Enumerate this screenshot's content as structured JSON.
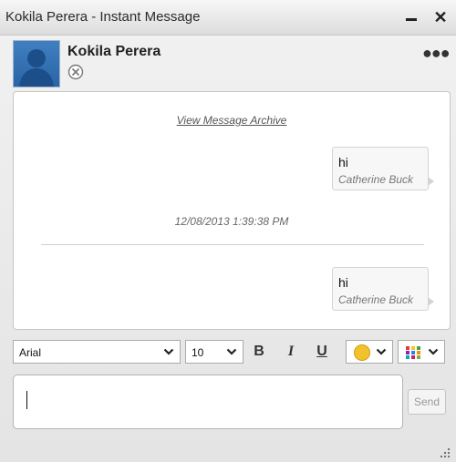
{
  "window": {
    "title": "Kokila Perera - Instant Message"
  },
  "contact": {
    "name": "Kokila Perera",
    "status_icon": "offline-status-icon"
  },
  "conversation": {
    "archive_link": "View Message Archive",
    "messages": [
      {
        "text": "hi",
        "sender": "Catherine Buck"
      },
      {
        "text": "hi",
        "sender": "Catherine Buck"
      }
    ],
    "timestamp": "12/08/2013 1:39:38 PM"
  },
  "toolbar": {
    "font": "Arial",
    "size": "10",
    "bold": "B",
    "italic": "I",
    "underline": "U"
  },
  "composer": {
    "value": "",
    "send_label": "Send"
  },
  "colors": {
    "accent": "#2a64a6",
    "emoji": "#f2c22c"
  }
}
